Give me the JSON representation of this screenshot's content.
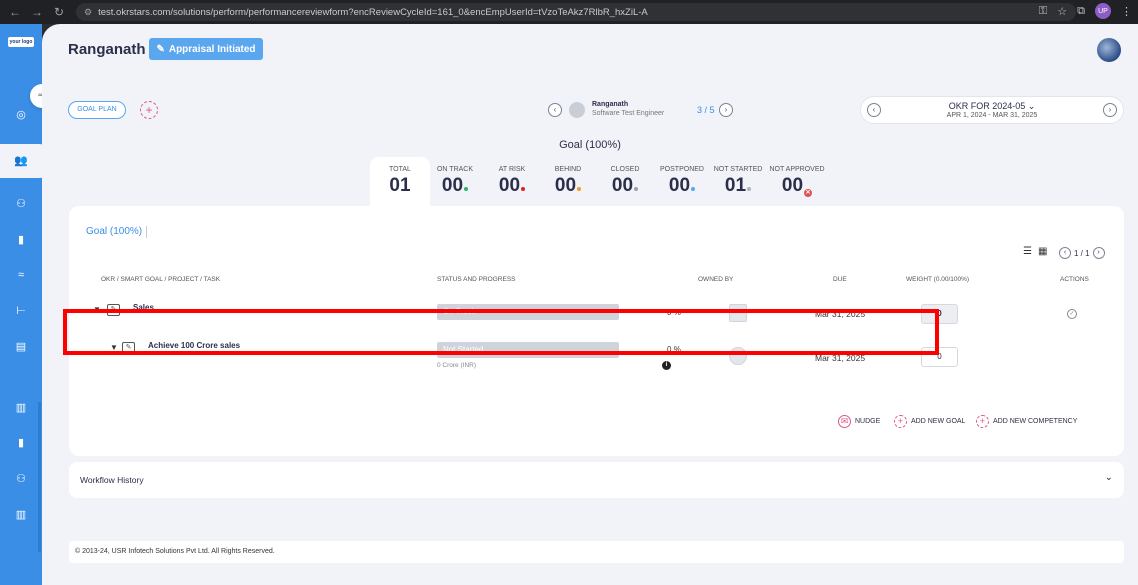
{
  "browser": {
    "url": "test.okrstars.com/solutions/perform/performancereviewform?encReviewCycleId=161_0&encEmpUserId=tVzoTeAkz7RlbR_hxZiL-A",
    "profile_label": "UP"
  },
  "sidebar": {
    "logo_text": "your logo"
  },
  "header": {
    "employee_name": "Ranganath",
    "status_button": "Appraisal Initiated"
  },
  "toolbar": {
    "goal_plan": "GOAL PLAN",
    "add_symbol": "+"
  },
  "employee_nav": {
    "name": "Ranganath",
    "role": "Software Test Engineer",
    "position": "3 / 5"
  },
  "cycle": {
    "title": "OKR FOR 2024-05",
    "dates": "APR 1, 2024 - MAR 31, 2025"
  },
  "summary": {
    "heading": "Goal (100%)",
    "stats": [
      {
        "label": "TOTAL",
        "value": "01",
        "dot": ""
      },
      {
        "label": "ON TRACK",
        "value": "00",
        "dot": "#2fb36b"
      },
      {
        "label": "AT RISK",
        "value": "00",
        "dot": "#e02020"
      },
      {
        "label": "BEHIND",
        "value": "00",
        "dot": "#f0a020"
      },
      {
        "label": "CLOSED",
        "value": "00",
        "dot": "#9aa0a6"
      },
      {
        "label": "POSTPONED",
        "value": "00",
        "dot": "#5aa6ef"
      },
      {
        "label": "NOT STARTED",
        "value": "01",
        "dot": "#b0b4bc"
      },
      {
        "label": "NOT APPROVED",
        "value": "00",
        "dot": "x"
      }
    ]
  },
  "goals_card": {
    "tab": "Goal (100%)",
    "pager": "1 / 1",
    "columns": {
      "task": "OKR / SMART GOAL / PROJECT / TASK",
      "status": "STATUS AND PROGRESS",
      "owned": "OWNED BY",
      "due": "DUE",
      "weight": "WEIGHT (0.00/100%)",
      "actions": "ACTIONS"
    },
    "rows": [
      {
        "name": "Sales",
        "status": "On Track",
        "pct": "0",
        "pct_unit": "%",
        "due": "Mar 31, 2025",
        "weight": "0"
      },
      {
        "name": "Achieve 100 Crore sales",
        "status": "Not Started",
        "target": "0 Crore (INR)",
        "pct": "0",
        "pct_unit": "%",
        "due": "Mar 31, 2025",
        "weight": "0"
      }
    ],
    "actions": {
      "nudge": "NUDGE",
      "add_goal": "ADD NEW GOAL",
      "add_competency": "ADD NEW COMPETENCY"
    }
  },
  "workflow": {
    "title": "Workflow History"
  },
  "footer": {
    "copyright": "© 2013-24, USR Infotech Solutions Pvt Ltd. All Rights Reserved."
  },
  "colors": {
    "accent": "#3a8ee6",
    "highlight": "#ff0000"
  }
}
